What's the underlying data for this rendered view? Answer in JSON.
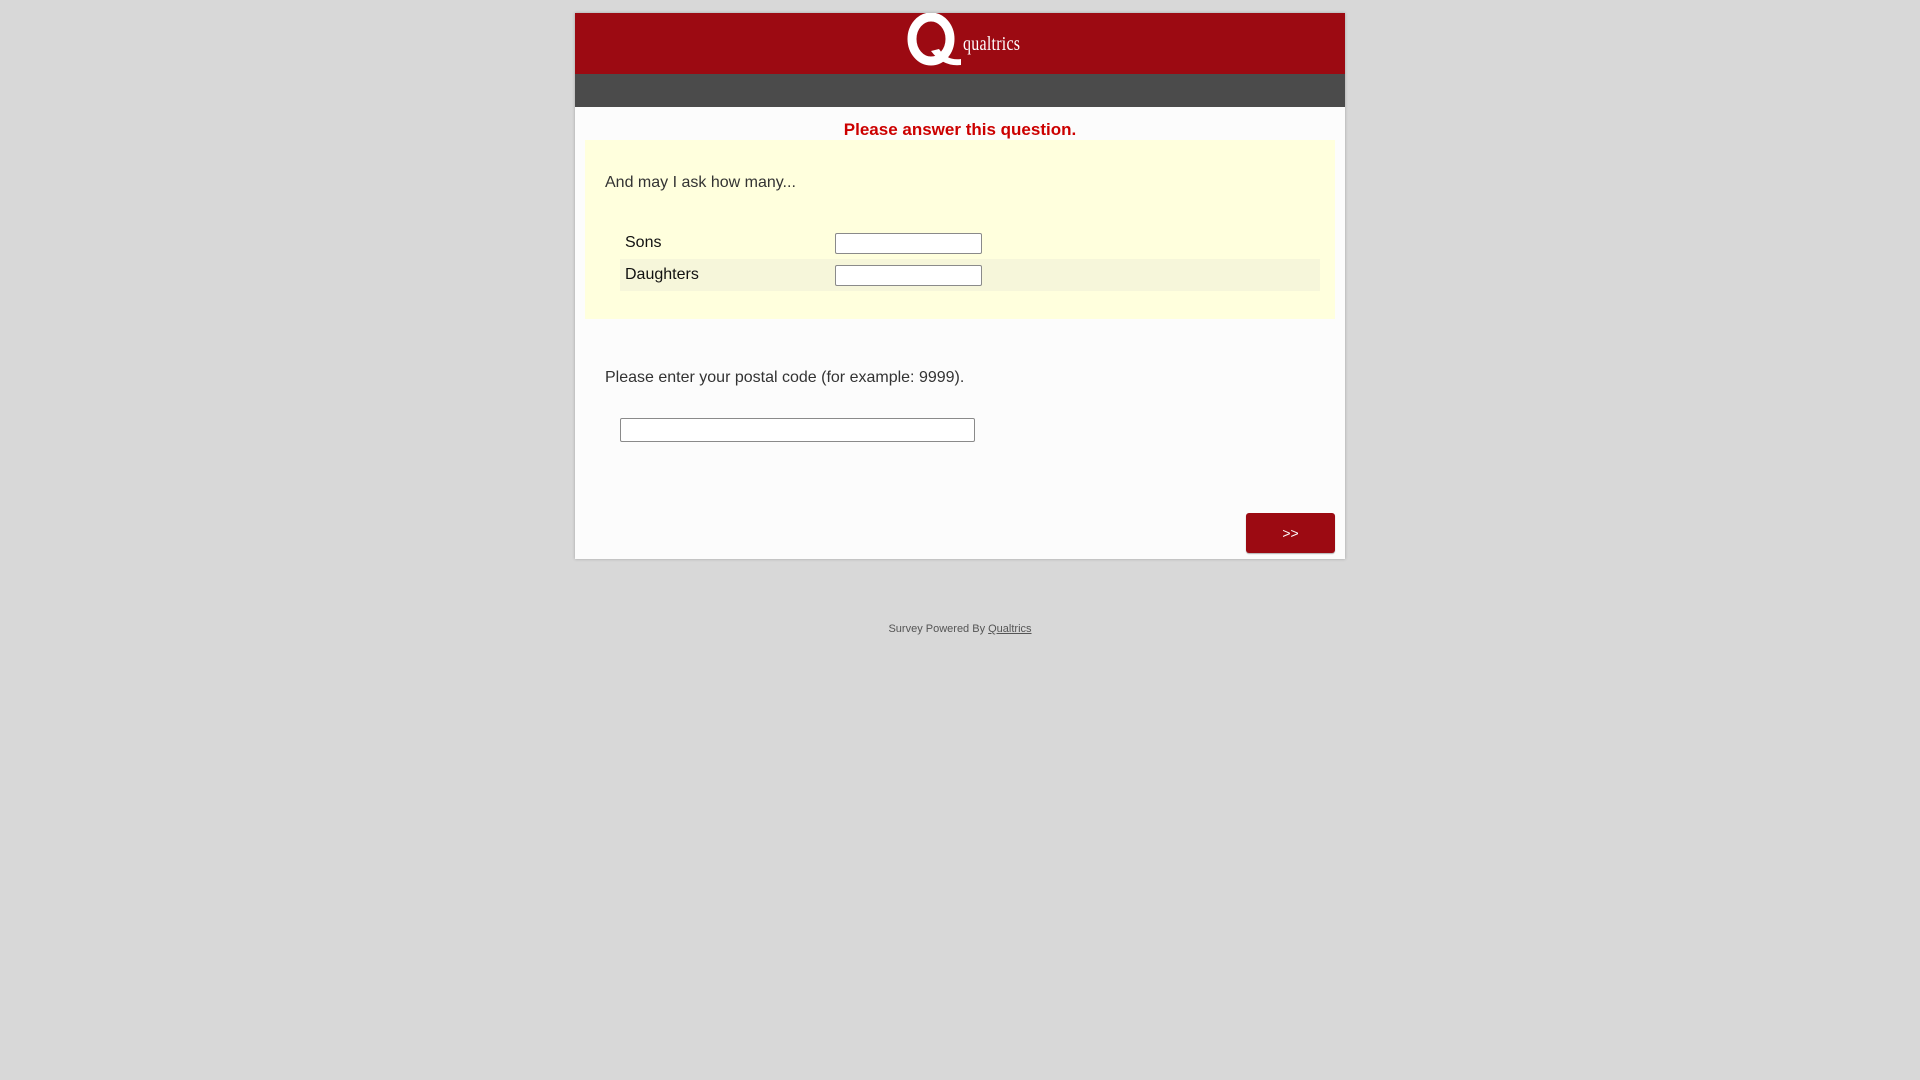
{
  "brand": {
    "logo_letter": "Q",
    "logo_text": "qualtrics",
    "header_color": "#9c0a12",
    "subbar_color": "#4b4b4b"
  },
  "error_message": "Please answer this question.",
  "question1": {
    "text": "And may I ask how many...",
    "rows": [
      {
        "label": "Sons",
        "value": ""
      },
      {
        "label": "Daughters",
        "value": ""
      }
    ]
  },
  "question2": {
    "text": "Please enter your postal code (for example: 9999).",
    "value": ""
  },
  "navigation": {
    "next_label": ">>"
  },
  "footer": {
    "prefix": "Survey Powered By ",
    "link_text": "Qualtrics"
  }
}
